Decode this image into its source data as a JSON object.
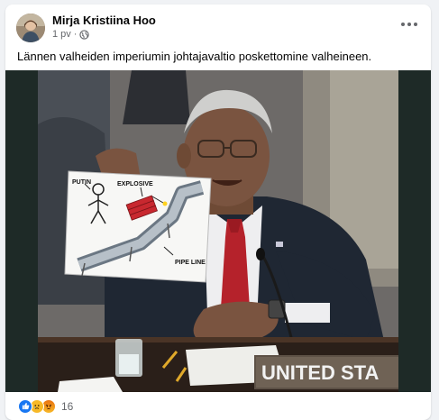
{
  "post": {
    "author": "Mirja Kristiina Hoo",
    "time": "1 pv",
    "separator": "·",
    "audience_icon": "globe-icon",
    "text": "Lännen valheiden imperiumin johtajavaltio poskettomine valheineen.",
    "reactions": {
      "types": [
        "like",
        "sad",
        "angry"
      ],
      "count": "16"
    }
  },
  "photo": {
    "sign_labels": {
      "putin": "PUTIN",
      "explosive": "EXPLOSIVE",
      "pipeline": "PIPE LINE"
    },
    "nameplate": "UNITED STA"
  }
}
